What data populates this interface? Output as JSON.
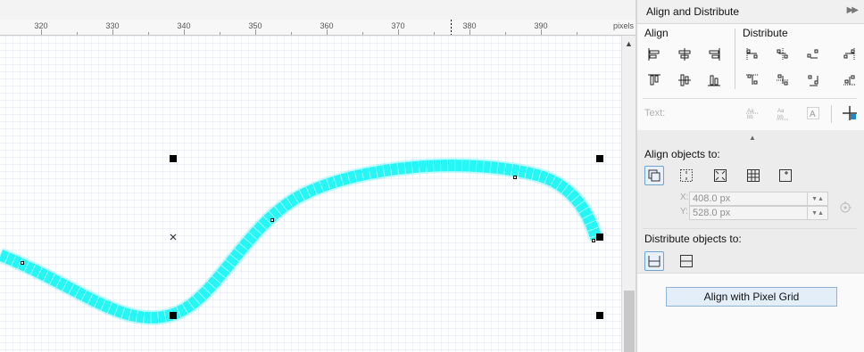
{
  "ruler": {
    "ticks": [
      "320",
      "330",
      "340",
      "350",
      "360",
      "370",
      "380",
      "390"
    ],
    "unit": "pixels"
  },
  "panel": {
    "title": "Align and Distribute",
    "collapse_icon": "double-chevron-right-icon",
    "align_heading": "Align",
    "distribute_heading": "Distribute",
    "text_label": "Text:",
    "align_objects_to": "Align objects to:",
    "x_label": "X:",
    "x_value": "408.0 px",
    "y_label": "Y:",
    "y_value": "528.0 px",
    "distribute_objects_to": "Distribute objects to:",
    "pixel_grid_button": "Align with Pixel Grid"
  },
  "colors": {
    "stroke": "#00f4f4",
    "grid_line": "#dde3ef",
    "handle": "#000000",
    "selected_border": "#6ea3d6"
  }
}
